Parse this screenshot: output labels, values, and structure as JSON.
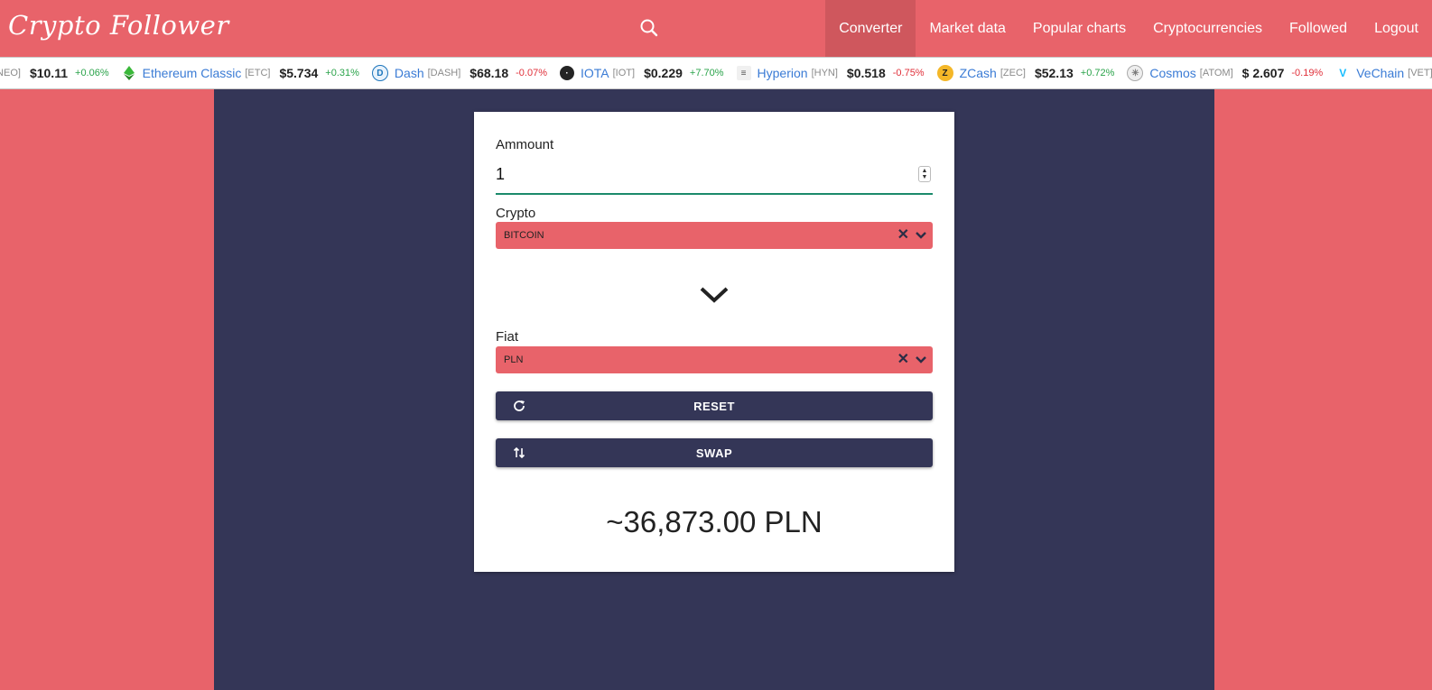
{
  "brand": {
    "title": "Crypto Follower"
  },
  "nav": {
    "search_icon": "search-icon",
    "links": [
      {
        "label": "Converter",
        "active": true
      },
      {
        "label": "Market data"
      },
      {
        "label": "Popular charts"
      },
      {
        "label": "Cryptocurrencies"
      },
      {
        "label": "Followed"
      },
      {
        "label": "Logout"
      }
    ]
  },
  "ticker": {
    "lead": {
      "sym": "[NEO]",
      "price": "$10.11",
      "change": "+0.06%"
    },
    "items": [
      {
        "name": "Ethereum Classic",
        "sym": "[ETC]",
        "price": "$5.734",
        "change": "+0.31%",
        "icon_color": "#3ab83a"
      },
      {
        "name": "Dash",
        "sym": "[DASH]",
        "price": "$68.18",
        "change": "-0.07%",
        "icon_color": "#1c75bc"
      },
      {
        "name": "IOTA",
        "sym": "[IOT]",
        "price": "$0.229",
        "change": "+7.70%",
        "icon_color": "#242424"
      },
      {
        "name": "Hyperion",
        "sym": "[HYN]",
        "price": "$0.518",
        "change": "-0.75%",
        "icon_color": "#666666"
      },
      {
        "name": "ZCash",
        "sym": "[ZEC]",
        "price": "$52.13",
        "change": "+0.72%",
        "icon_color": "#f4b728"
      },
      {
        "name": "Cosmos",
        "sym": "[ATOM]",
        "price": "$ 2.607",
        "change": "-0.19%",
        "icon_color": "#9a9a9a"
      },
      {
        "name": "VeChain",
        "sym": "[VET]",
        "price": "",
        "change": "",
        "icon_color": "#15bdff"
      }
    ]
  },
  "converter": {
    "amount_label": "Ammount",
    "amount_value": "1",
    "crypto_label": "Crypto",
    "crypto_value": "BITCOIN",
    "fiat_label": "Fiat",
    "fiat_value": "PLN",
    "reset_label": "RESET",
    "swap_label": "SWAP",
    "result": "~36,873.00 PLN"
  },
  "colors": {
    "accent": "#e8636a",
    "dark": "#343657",
    "focus": "#1b8a6b"
  }
}
